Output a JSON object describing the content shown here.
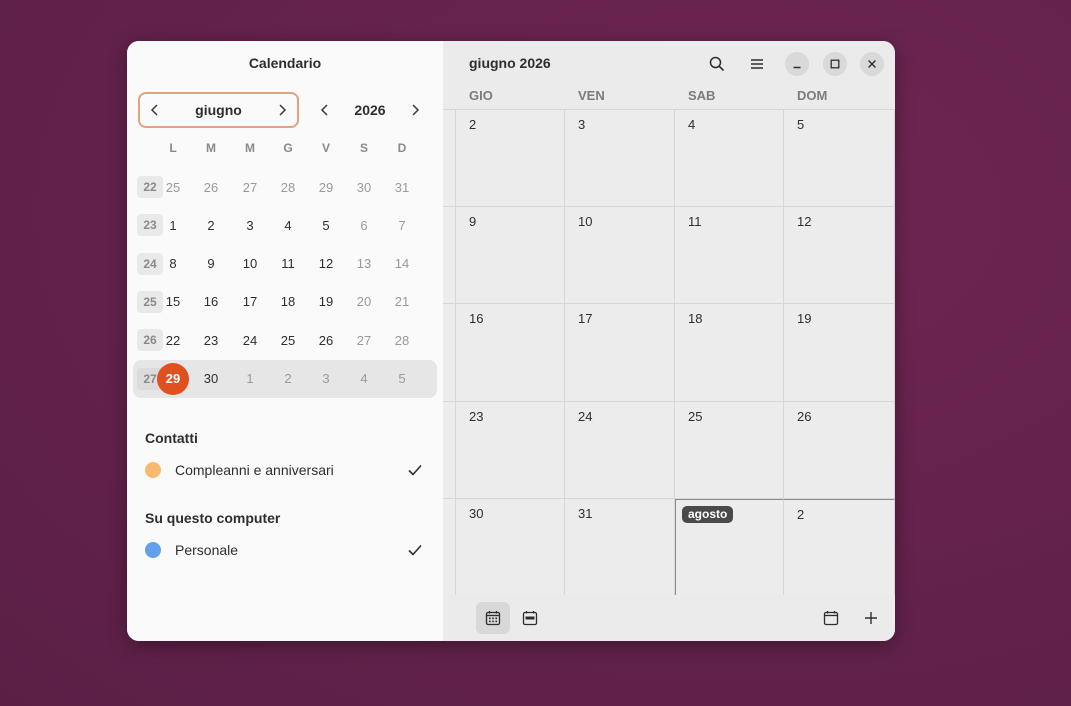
{
  "sidebar": {
    "title": "Calendario",
    "month_label": "giugno",
    "year_label": "2026",
    "weekdays": [
      "L",
      "M",
      "M",
      "G",
      "V",
      "S",
      "D"
    ],
    "weeks": [
      {
        "num": "22",
        "days": [
          {
            "d": "25",
            "dim": true
          },
          {
            "d": "26",
            "dim": true
          },
          {
            "d": "27",
            "dim": true
          },
          {
            "d": "28",
            "dim": true
          },
          {
            "d": "29",
            "dim": true
          },
          {
            "d": "30",
            "dim": true
          },
          {
            "d": "31",
            "dim": true
          }
        ]
      },
      {
        "num": "23",
        "days": [
          {
            "d": "1"
          },
          {
            "d": "2"
          },
          {
            "d": "3"
          },
          {
            "d": "4"
          },
          {
            "d": "5"
          },
          {
            "d": "6",
            "dim": true
          },
          {
            "d": "7",
            "dim": true
          }
        ]
      },
      {
        "num": "24",
        "days": [
          {
            "d": "8"
          },
          {
            "d": "9"
          },
          {
            "d": "10"
          },
          {
            "d": "11"
          },
          {
            "d": "12"
          },
          {
            "d": "13",
            "dim": true
          },
          {
            "d": "14",
            "dim": true
          }
        ]
      },
      {
        "num": "25",
        "days": [
          {
            "d": "15"
          },
          {
            "d": "16"
          },
          {
            "d": "17"
          },
          {
            "d": "18"
          },
          {
            "d": "19"
          },
          {
            "d": "20",
            "dim": true
          },
          {
            "d": "21",
            "dim": true
          }
        ]
      },
      {
        "num": "26",
        "days": [
          {
            "d": "22"
          },
          {
            "d": "23"
          },
          {
            "d": "24"
          },
          {
            "d": "25"
          },
          {
            "d": "26"
          },
          {
            "d": "27",
            "dim": true
          },
          {
            "d": "28",
            "dim": true
          }
        ]
      },
      {
        "num": "27",
        "current": true,
        "days": [
          {
            "d": "29",
            "today": true
          },
          {
            "d": "30"
          },
          {
            "d": "1",
            "dim": true
          },
          {
            "d": "2",
            "dim": true
          },
          {
            "d": "3",
            "dim": true
          },
          {
            "d": "4",
            "dim": true
          },
          {
            "d": "5",
            "dim": true
          }
        ]
      }
    ],
    "sections": [
      {
        "title": "Contatti",
        "items": [
          {
            "name": "Compleanni e anniversari",
            "color": "#f8bb6d",
            "checked": true
          }
        ]
      },
      {
        "title": "Su questo computer",
        "items": [
          {
            "name": "Personale",
            "color": "#62a0ea",
            "checked": true
          }
        ]
      }
    ]
  },
  "main": {
    "title": "giugno 2026",
    "columns": [
      "GIO",
      "VEN",
      "SAB",
      "DOM"
    ],
    "rows": [
      [
        {
          "n": "2"
        },
        {
          "n": "3"
        },
        {
          "n": "4"
        },
        {
          "n": "5"
        }
      ],
      [
        {
          "n": "9"
        },
        {
          "n": "10"
        },
        {
          "n": "11"
        },
        {
          "n": "12"
        }
      ],
      [
        {
          "n": "16"
        },
        {
          "n": "17"
        },
        {
          "n": "18"
        },
        {
          "n": "19"
        }
      ],
      [
        {
          "n": "23"
        },
        {
          "n": "24"
        },
        {
          "n": "25"
        },
        {
          "n": "26"
        }
      ],
      [
        {
          "n": "30"
        },
        {
          "n": "31"
        },
        {
          "badge": "agosto"
        },
        {
          "n": "2"
        }
      ]
    ]
  },
  "colors": {
    "accent": "#e0511f",
    "month_outline": "#e0a283",
    "desktop": "#6b2550"
  },
  "icons": {
    "search": "search-icon",
    "menu": "menu-icon",
    "minimize": "minimize-icon",
    "maximize": "maximize-icon",
    "close": "close-icon",
    "month_view": "calendar-month-icon",
    "week_view": "calendar-week-icon",
    "today": "calendar-today-icon",
    "add": "plus-icon"
  }
}
